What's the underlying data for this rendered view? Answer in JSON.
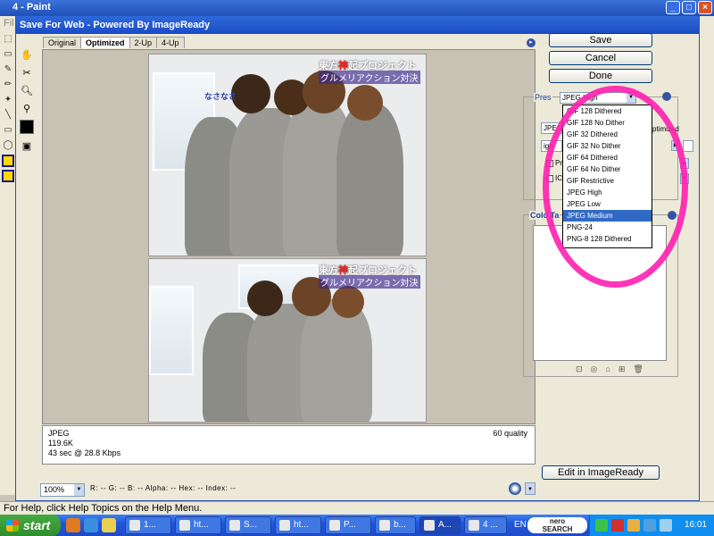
{
  "paint": {
    "title": "4 - Paint",
    "menu_fragment": "Fil",
    "status_text": "For Help, click Help Topics on the Help Menu."
  },
  "dialog": {
    "title": "Save For Web - Powered By ImageReady",
    "tabs": [
      "Original",
      "Optimized",
      "2-Up",
      "4-Up"
    ],
    "active_tab": "Optimized",
    "image_caption_top": "東方",
    "image_caption_red": "神",
    "image_caption_rest": "起プロジェクト",
    "image_subtitle": "グルメリアクション対決",
    "image_watermark": "なさなさ",
    "info": {
      "format": "JPEG",
      "size": "119.6K",
      "time": "43 sec @ 28.8 Kbps",
      "quality": "60 quality"
    },
    "zoom": "100%",
    "readout": "R:  --  G:  --  B:  --  Alpha:  --  Hex:  --   Index:  --",
    "buttons": {
      "save": "Save",
      "cancel": "Cancel",
      "done": "Done",
      "edit_in_imageready": "Edit in ImageReady"
    },
    "settings": {
      "preset_label": "Pres",
      "preset_value": "JPEG High",
      "format_value": "JPEG",
      "quality_value": "igh",
      "optimized_label": "ptimized",
      "progressive_label": "Progress",
      "icc_label": "ICC Pro"
    },
    "color_table_label": "Colo Ta",
    "preset_options": [
      "GIF 128 Dithered",
      "GIF 128 No Dither",
      "GIF 32 Dithered",
      "GIF 32 No Dither",
      "GIF 64 Dithered",
      "GIF 64 No Dither",
      "GIF Restrictive",
      "JPEG High",
      "JPEG Low",
      "JPEG Medium",
      "PNG-24",
      "PNG-8 128 Dithered"
    ],
    "highlighted_option": "JPEG Medium"
  },
  "taskbar": {
    "start_label": "start",
    "tasks": [
      "1...",
      "ht...",
      "S...",
      "ht...",
      "P...",
      "b...",
      "A...",
      "4 ..."
    ],
    "language": "EN",
    "search_brand": "nero",
    "search_sub": "SEARCH",
    "clock": "16:01"
  },
  "colors": {
    "annotation": "#ff1fb0",
    "highlight": "#316ac5",
    "titlebar": "#1f4fb8"
  }
}
